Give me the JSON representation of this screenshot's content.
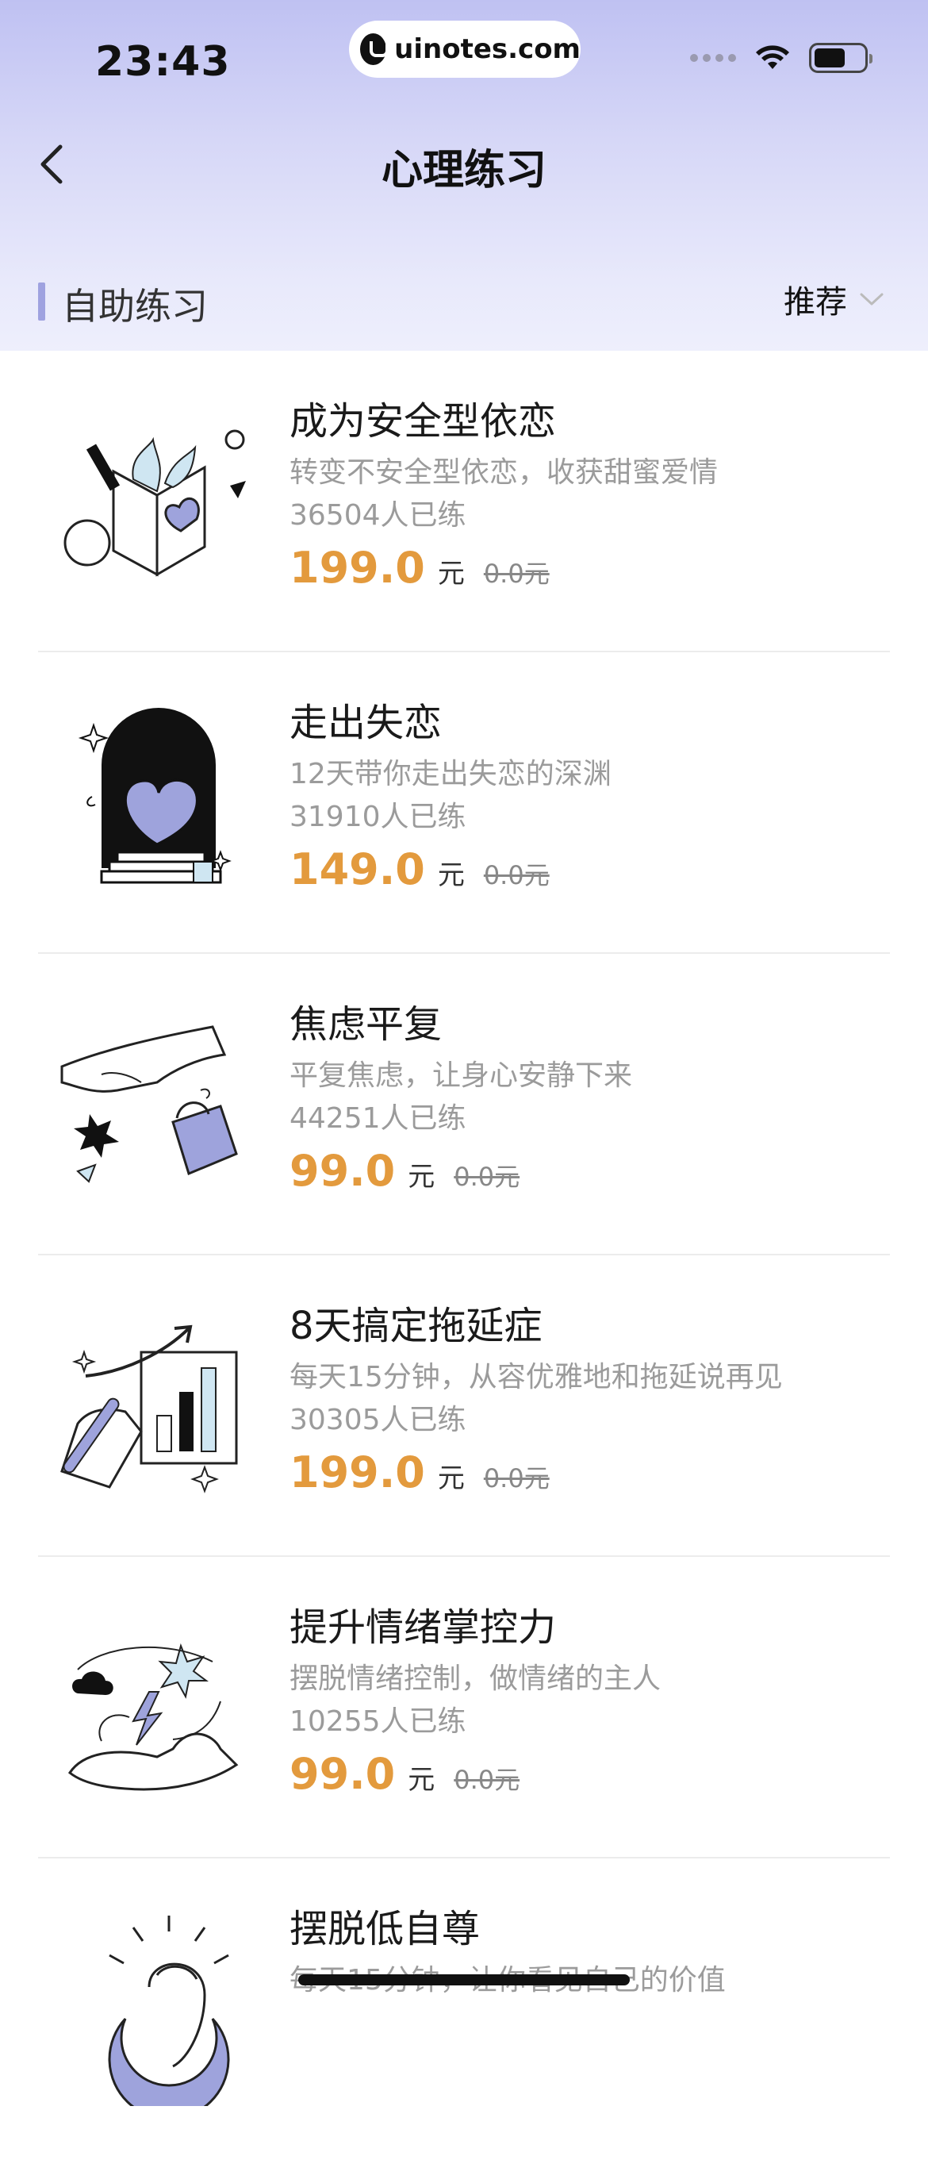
{
  "status_bar": {
    "time": "23:43",
    "url": "uinotes.com"
  },
  "nav": {
    "title": "心理练习"
  },
  "section": {
    "title": "自助练习",
    "sort_label": "推荐"
  },
  "colors": {
    "accent_price": "#e39a3d",
    "header_gradient_top": "#bfc1f2",
    "illustration_purple": "#9ea3dc"
  },
  "items": [
    {
      "title": "成为安全型依恋",
      "desc": "转变不安全型依恋，收获甜蜜爱情",
      "count": "36504人已练",
      "price": "199.0",
      "unit": "元",
      "original": "0.0元",
      "icon": "book-heart-illustration"
    },
    {
      "title": "走出失恋",
      "desc": "12天带你走出失恋的深渊",
      "count": "31910人已练",
      "price": "149.0",
      "unit": "元",
      "original": "0.0元",
      "icon": "arch-heart-illustration"
    },
    {
      "title": "焦虑平复",
      "desc": "平复焦虑，让身心安静下来",
      "count": "44251人已练",
      "price": "99.0",
      "unit": "元",
      "original": "0.0元",
      "icon": "hand-bag-illustration"
    },
    {
      "title": "8天搞定拖延症",
      "desc": "每天15分钟，从容优雅地和拖延说再见",
      "count": "30305人已练",
      "price": "199.0",
      "unit": "元",
      "original": "0.0元",
      "icon": "hand-chart-illustration"
    },
    {
      "title": "提升情绪掌控力",
      "desc": "摆脱情绪控制，做情绪的主人",
      "count": "10255人已练",
      "price": "99.0",
      "unit": "元",
      "original": "0.0元",
      "icon": "hand-storm-illustration"
    },
    {
      "title": "摆脱低自尊",
      "desc": "每天15分钟，让你看见自己的价值",
      "icon": "statue-moon-illustration"
    }
  ]
}
